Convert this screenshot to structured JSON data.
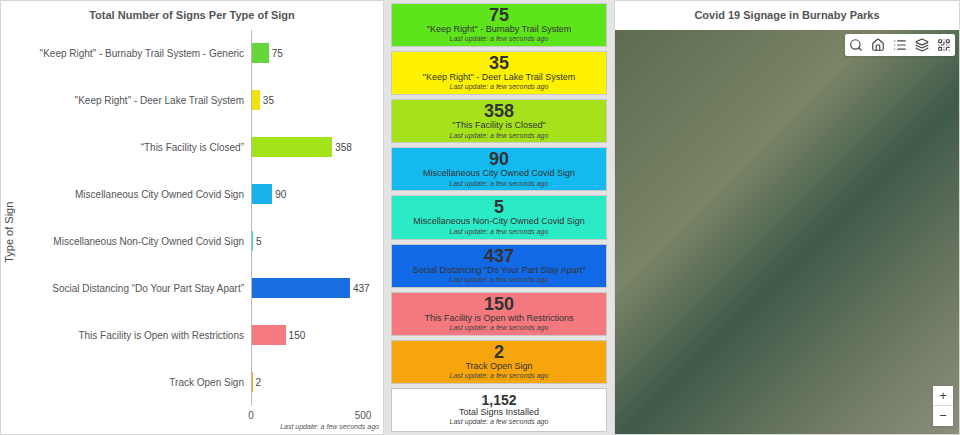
{
  "chart": {
    "title": "Total Number of Signs Per Type of Sign",
    "axis_label": "Type of Sign",
    "ticks": [
      "0",
      "500"
    ],
    "updated": "Last update: a few seconds ago",
    "bars": [
      {
        "label": "\"Keep Right\" - Burnaby Trail System - Generic",
        "value": 75,
        "value_text": "75",
        "color": "#66d63a"
      },
      {
        "label": "\"Keep Right\" - Deer Lake Trail System",
        "value": 35,
        "value_text": "35",
        "color": "#f2e30f"
      },
      {
        "label": "“This Facility is Closed”",
        "value": 358,
        "value_text": "358",
        "color": "#a3e319"
      },
      {
        "label": "Miscellaneous City Owned Covid Sign",
        "value": 90,
        "value_text": "90",
        "color": "#1ab2ec"
      },
      {
        "label": "Miscellaneous Non-City Owned Covid Sign",
        "value": 5,
        "value_text": "5",
        "color": "#2ee0c0"
      },
      {
        "label": "Social Distancing “Do Your Part Stay Apart”",
        "value": 437,
        "value_text": "437",
        "color": "#1a6fe0"
      },
      {
        "label": "This Facility is Open with Restrictions",
        "value": 150,
        "value_text": "150",
        "color": "#f47a7f"
      },
      {
        "label": "Track Open Sign",
        "value": 2,
        "value_text": "2",
        "color": "#f5a00f"
      }
    ]
  },
  "cards": [
    {
      "value": "75",
      "label": "\"Keep Right\" - Burnaby Trail System",
      "updated": "Last update: a few seconds ago",
      "color": "#5ee41a"
    },
    {
      "value": "35",
      "label": "\"Keep Right\" - Deer Lake Trail System",
      "updated": "Last update: a few seconds ago",
      "color": "#fff200"
    },
    {
      "value": "358",
      "label": "\"This Facility is Closed\"",
      "updated": "Last update: a few seconds ago",
      "color": "#a5e21c"
    },
    {
      "value": "90",
      "label": "Miscellaneous City Owned Covid Sign",
      "updated": "Last update: a few seconds ago",
      "color": "#14b9f0"
    },
    {
      "value": "5",
      "label": "Miscellaneous Non-City Owned Covid Sign",
      "updated": "Last update: a few seconds ago",
      "color": "#2bebc6"
    },
    {
      "value": "437",
      "label": "Social Distancing \"Do Your Part Stay Apart\"",
      "updated": "Last update: a few seconds ago",
      "color": "#1269e6"
    },
    {
      "value": "150",
      "label": "This Facility is Open with Restrictions",
      "updated": "Last update: a few seconds ago",
      "color": "#f4797f"
    },
    {
      "value": "2",
      "label": "Track Open Sign",
      "updated": "Last update: a few seconds ago",
      "color": "#f7a50d"
    }
  ],
  "total": {
    "value": "1,152",
    "label": "Total Signs Installed",
    "updated": "Last update: a few seconds ago"
  },
  "map": {
    "title": "Covid 19 Signage in Burnaby Parks",
    "zoom_in": "+",
    "zoom_out": "−"
  }
}
